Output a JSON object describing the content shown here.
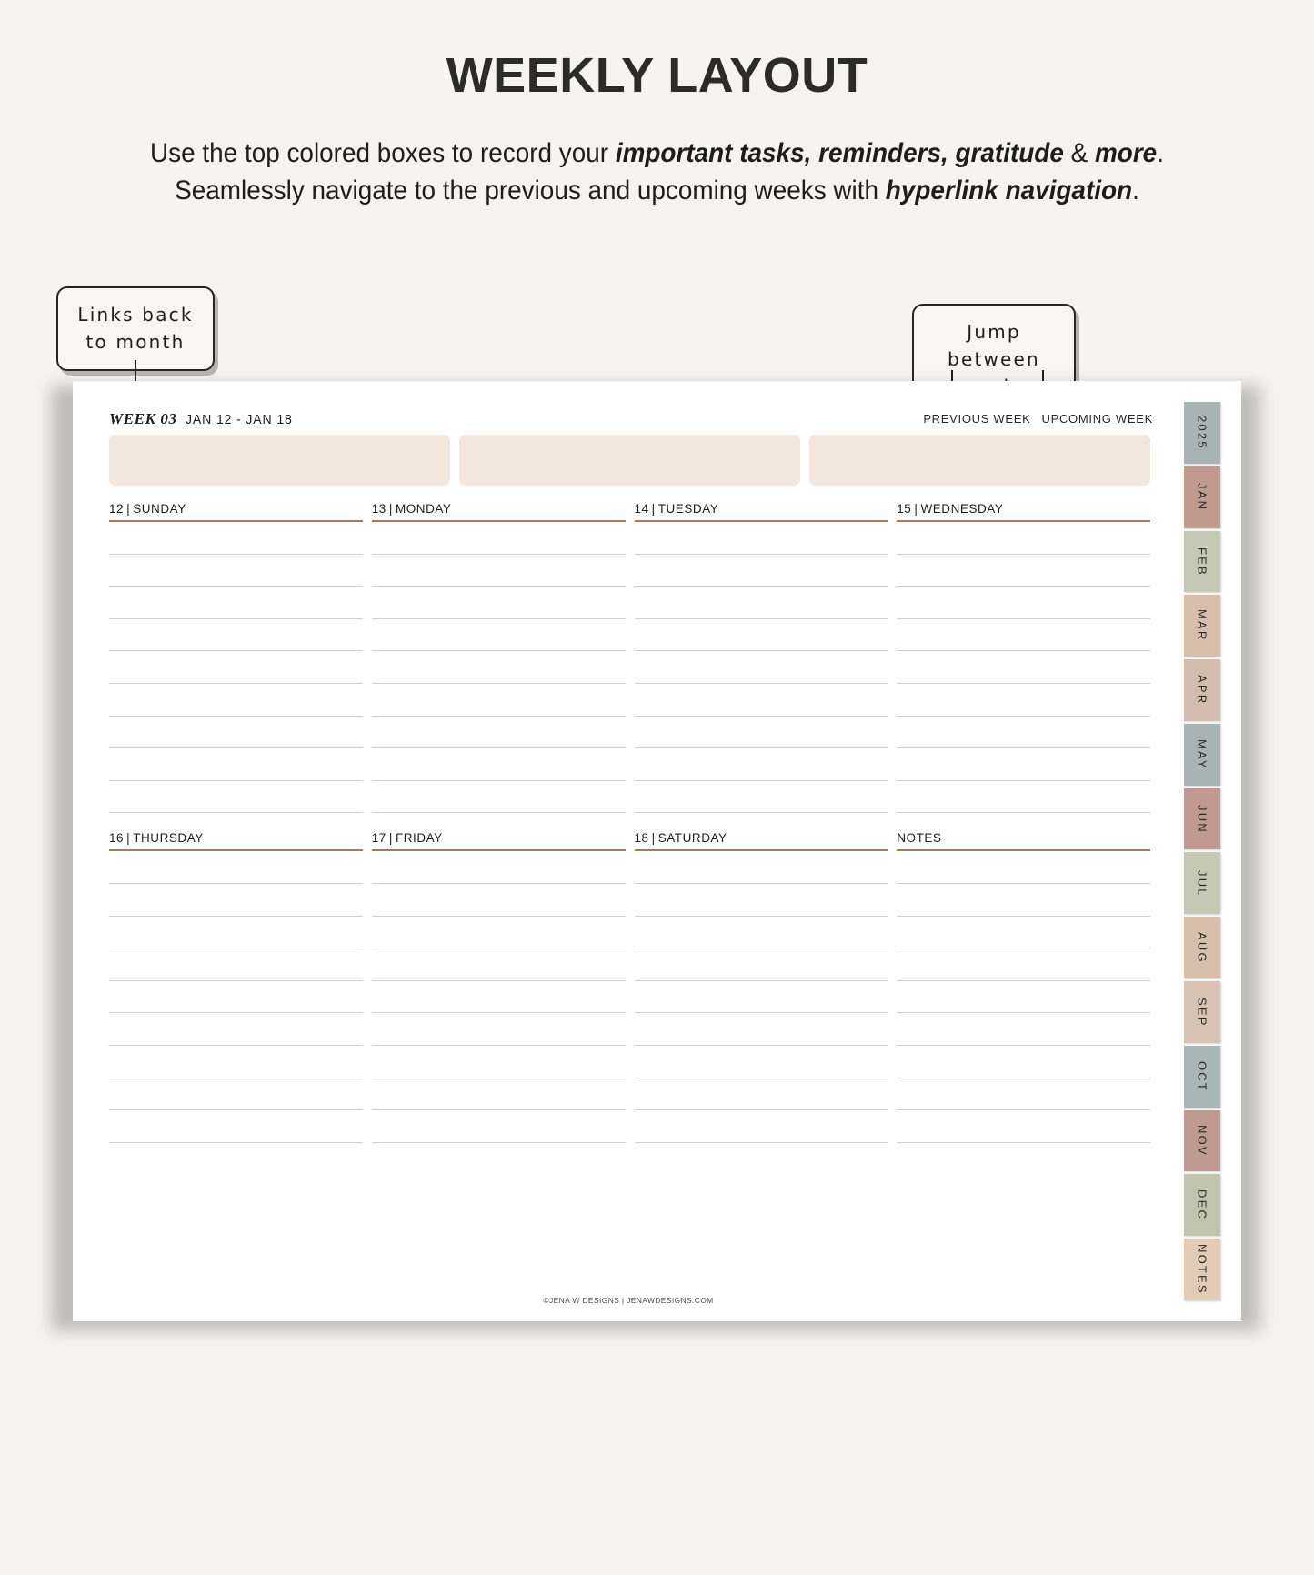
{
  "header": {
    "title": "WEEKLY LAYOUT",
    "subtitle_line1_prefix": "Use the top colored boxes to record your ",
    "subtitle_line1_bold": "important tasks, reminders, gratitude",
    "subtitle_line1_mid": " & ",
    "subtitle_line1_bold2": "more",
    "subtitle_line1_suffix": ".",
    "subtitle_line2_prefix": "Seamlessly navigate to the  previous and upcoming weeks with ",
    "subtitle_line2_bold": "hyperlink navigation",
    "subtitle_line2_suffix": "."
  },
  "callouts": {
    "month": "Links back to month",
    "weeks": "Jump between weeks"
  },
  "planner": {
    "week_number": "WEEK 03",
    "week_range": "JAN 12 - JAN 18",
    "nav": {
      "previous": "PREVIOUS WEEK",
      "upcoming": "UPCOMING WEEK"
    },
    "top_boxes": [
      "",
      "",
      ""
    ],
    "days_row1": [
      {
        "num": "12",
        "name": "SUNDAY"
      },
      {
        "num": "13",
        "name": "MONDAY"
      },
      {
        "num": "14",
        "name": "TUESDAY"
      },
      {
        "num": "15",
        "name": "WEDNESDAY"
      }
    ],
    "days_row2": [
      {
        "num": "16",
        "name": "THURSDAY"
      },
      {
        "num": "17",
        "name": "FRIDAY"
      },
      {
        "num": "18",
        "name": "SATURDAY"
      },
      {
        "num": "",
        "name": "NOTES"
      }
    ],
    "credit": "©JENA W DESIGNS | JENAWDESIGNS.COM"
  },
  "tabs": [
    {
      "label": "2025",
      "color": "#a8b3b4"
    },
    {
      "label": "JAN",
      "color": "#c09a8d"
    },
    {
      "label": "FEB",
      "color": "#c5c8b4"
    },
    {
      "label": "MAR",
      "color": "#d7bfab"
    },
    {
      "label": "APR",
      "color": "#d4bdae"
    },
    {
      "label": "MAY",
      "color": "#a8b3b4"
    },
    {
      "label": "JUN",
      "color": "#c09a92"
    },
    {
      "label": "JUL",
      "color": "#c5c8b4"
    },
    {
      "label": "AUG",
      "color": "#d7bfab"
    },
    {
      "label": "SEP",
      "color": "#d8c2b4"
    },
    {
      "label": "OCT",
      "color": "#a8b6b8"
    },
    {
      "label": "NOV",
      "color": "#bf9a93"
    },
    {
      "label": "DEC",
      "color": "#c0c4ae"
    },
    {
      "label": "NOTES",
      "color": "#e3cbb6"
    }
  ],
  "colors": {
    "page_background": "#f5f4f2",
    "top_box": "#f2e6dd",
    "day_underline": "#ab7758",
    "rule_line": "#cfcfcd",
    "ink": "#1d1d1b"
  },
  "line_counts": {
    "row1": 9,
    "row2": 9
  }
}
